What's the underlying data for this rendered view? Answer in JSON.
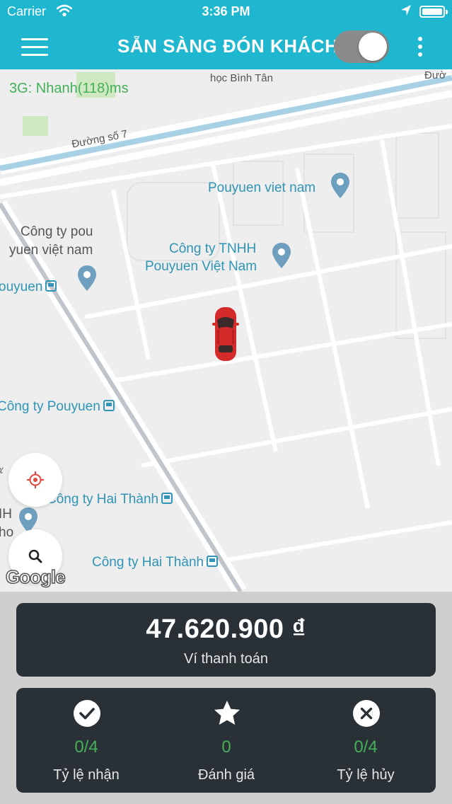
{
  "status_bar": {
    "carrier": "Carrier",
    "time": "3:36 PM"
  },
  "header": {
    "title": "SẴN SÀNG ĐÓN KHÁCH",
    "ready_toggle": "on"
  },
  "map": {
    "network": "3G: Nhanh(118)ms",
    "labels": {
      "school": "học Bình Tân",
      "road_top_right": "Đườ",
      "road_7": "Đường số 7",
      "pouyuen_viet_nam": "Pouyuen viet nam",
      "cong_ty_pou": "Công ty pou",
      "yuen_viet_nam": "yuen việt nam",
      "tnhh_line1": "Công ty TNHH",
      "tnhh_line2": "Pouyuen Việt Nam",
      "ouyuen": "ouyuen",
      "cong_ty_pouyuen": "Công ty Pouyuen",
      "cong_ty_hai_thanh_1": "Công ty Hai Thành",
      "cong_ty_hai_thanh_2": "Công ty Hai Thành",
      "left_h": "IH",
      "left_ho": "ho",
      "left_road": "Đườ"
    },
    "attribution": "Google"
  },
  "wallet": {
    "amount": "47.620.900 ₫",
    "label": "Ví thanh toán"
  },
  "stats": [
    {
      "icon": "check-circle-icon",
      "value": "0/4",
      "label": "Tỷ lệ nhận"
    },
    {
      "icon": "star-circle-icon",
      "value": "0",
      "label": "Đánh giá"
    },
    {
      "icon": "x-circle-icon",
      "value": "0/4",
      "label": "Tỷ lệ hủy"
    }
  ],
  "colors": {
    "header": "#1fb6cf",
    "card": "#2a3136",
    "stat_value": "#44b05a",
    "map_label": "#2f94b5",
    "car": "#d42a2a",
    "locate_icon": "#e2483d"
  }
}
